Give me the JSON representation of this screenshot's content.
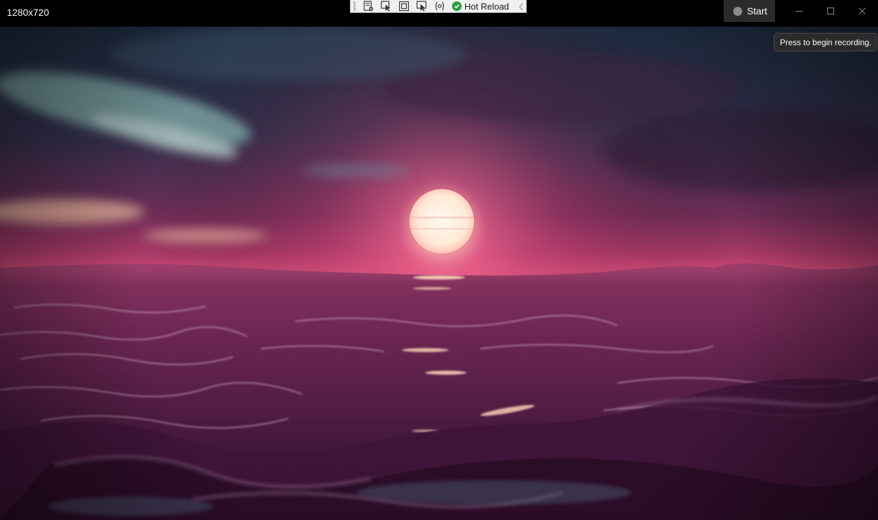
{
  "window": {
    "resolution_label": "1280x720"
  },
  "debug_toolbar": {
    "hot_reload_label": "Hot Reload",
    "hot_reload_status_color": "#2e9e44"
  },
  "recorder": {
    "start_label": "Start",
    "tooltip": "Press to begin recording."
  },
  "scene": {
    "description_colors": {
      "sky_top": "#1c2a3e",
      "sky_glow": "#d0406e",
      "sun": "#fff3dc",
      "water_dark": "#3a1634",
      "water_highlight": "#c8a2c8"
    }
  }
}
